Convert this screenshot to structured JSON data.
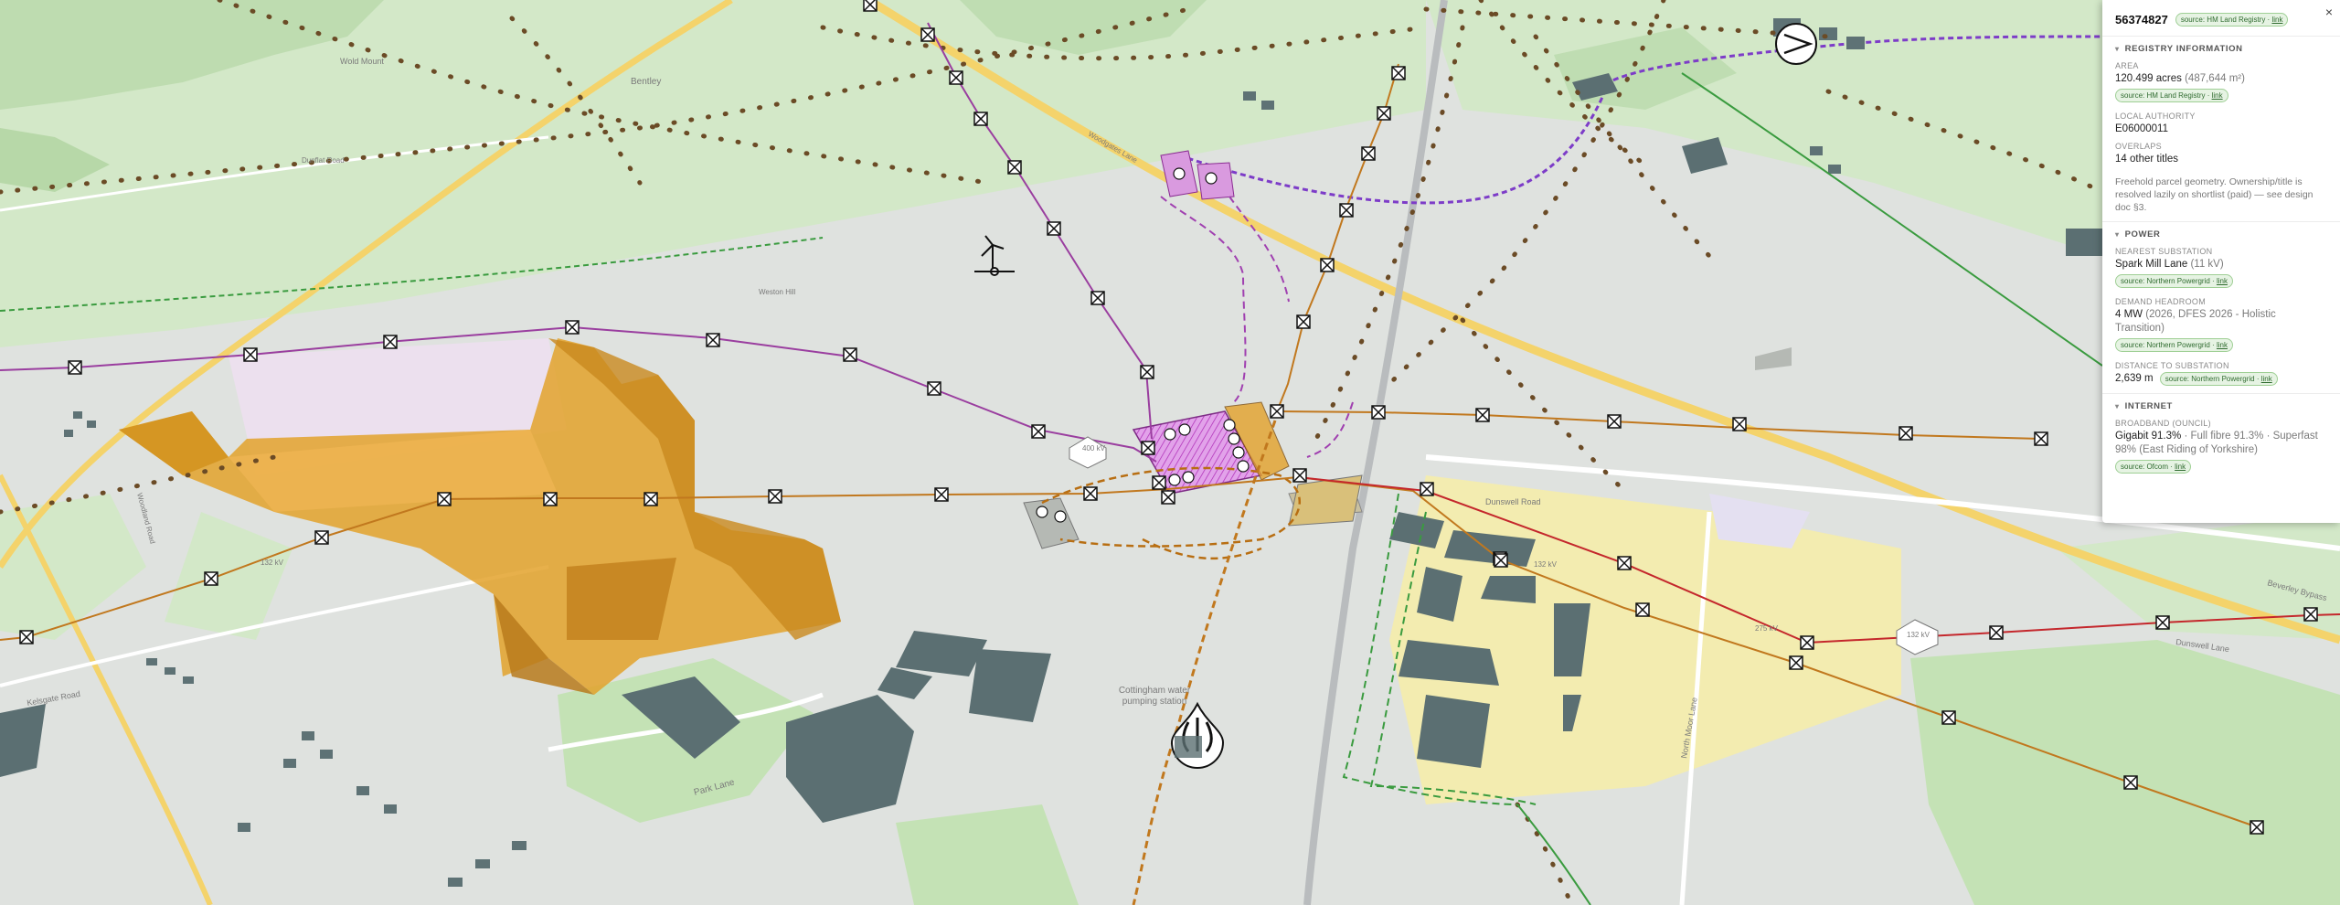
{
  "map": {
    "place_labels": [
      "Bentley",
      "Wold Mount",
      "Cottingham water pumping station",
      "Dunswell Road",
      "Park Lane",
      "North Moor Lane",
      "Beverley Bypass",
      "Dunswell Lane",
      "Dunflat Road",
      "Kelsgate Road",
      "Woodland Road",
      "Weston Hill",
      "Woodgates Lane"
    ],
    "line_labels": [
      "132 kV",
      "132 kV",
      "275 kV",
      "400 kV",
      "132 kV"
    ],
    "facility_name": "Cottingham water pumping station",
    "colors": {
      "land_green": "#d6e9cd",
      "land_grey": "#dfe2df",
      "field_green": "#c4e2b5",
      "pylon_line_purple": "#9a3e9f",
      "power_line_orange": "#c1781e",
      "power_line_red": "#c4272c",
      "power_line_green": "#3a9b3f",
      "dotted_line": "#6b4b26",
      "parcel_fill": "#e3a22b",
      "industrial_yellow": "#f3ecb0",
      "building": "#5b6f72",
      "road_yellow": "#f4d36b"
    }
  },
  "panel": {
    "close_label": "×",
    "title": "56374827",
    "title_source": "source: HM Land Registry",
    "link_label": "link",
    "sections": {
      "registry": "REGISTRY INFORMATION",
      "power": "POWER",
      "internet": "INTERNET"
    },
    "area": {
      "label": "AREA",
      "value": "120.499 acres",
      "secondary": "(487,644 m²)",
      "source": "source: HM Land Registry"
    },
    "local_authority": {
      "label": "LOCAL AUTHORITY",
      "value": "E06000011"
    },
    "overlaps": {
      "label": "OVERLAPS",
      "value": "14 other titles"
    },
    "note": "Freehold parcel geometry. Ownership/title is resolved lazily on shortlist (paid) — see design doc §3.",
    "nearest_substation": {
      "label": "NEAREST SUBSTATION",
      "value": "Spark Mill Lane",
      "secondary": "(11 kV)",
      "source": "source: Northern Powergrid"
    },
    "demand_headroom": {
      "label": "DEMAND HEADROOM",
      "value": "4 MW",
      "secondary": "(2026, DFES 2026 - Holistic Transition)",
      "source": "source: Northern Powergrid"
    },
    "distance": {
      "label": "DISTANCE TO SUBSTATION",
      "value": "2,639 m",
      "source": "source: Northern Powergrid"
    },
    "broadband": {
      "label": "BROADBAND (OUNCIL)",
      "value": "Gigabit 91.3%",
      "secondary": "· Full fibre 91.3% · Superfast 98% (East Riding of Yorkshire)",
      "source": "source: Ofcom"
    }
  }
}
